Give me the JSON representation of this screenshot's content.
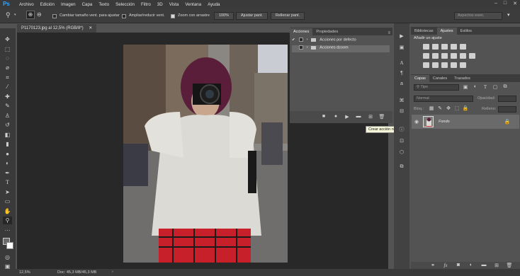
{
  "app": {
    "logo": "Ps"
  },
  "menu": [
    "Archivo",
    "Edición",
    "Imagen",
    "Capa",
    "Texto",
    "Selección",
    "Filtro",
    "3D",
    "Vista",
    "Ventana",
    "Ayuda"
  ],
  "options": {
    "resize_window": "Cambiar tamaño vent. para ajustar",
    "zoom_all": "Ampliar/reducir vent.",
    "scrubby_zoom": "Zoom con arrastre",
    "zoom_100": "100%",
    "fit_screen": "Ajustar pant.",
    "fill_screen": "Rellenar pant.",
    "workspace_search": "Aspectos esen."
  },
  "document": {
    "tab_title": "P1170123.jpg al 12,5% (RGB/8*)"
  },
  "status": {
    "zoom": "12,5%",
    "doc_size": "Doc: 45,3 MB/45,3 MB"
  },
  "actions_panel": {
    "tabs": [
      "Acciones",
      "Propiedades"
    ],
    "items": [
      "Acciones por defecto",
      "Acciones dzoom"
    ]
  },
  "tooltip": "Crear acción nueva",
  "adjustments_panel": {
    "tabs": [
      "Bibliotecas",
      "Ajustes",
      "Estilos"
    ],
    "add_label": "Añadir un ajuste"
  },
  "layers_panel": {
    "tabs": [
      "Capas",
      "Canales",
      "Trazados"
    ],
    "filter": "Tipo",
    "blend_mode": "Normal",
    "opacity_label": "Opacidad:",
    "lock_label": "Bloq.:",
    "fill_label": "Relleno:",
    "layer_name": "Fondo"
  },
  "colors": {
    "accent": "#31a8ff",
    "ui_dark": "#3a3a3a",
    "panel": "#535353",
    "canvas_bg": "#282828"
  }
}
